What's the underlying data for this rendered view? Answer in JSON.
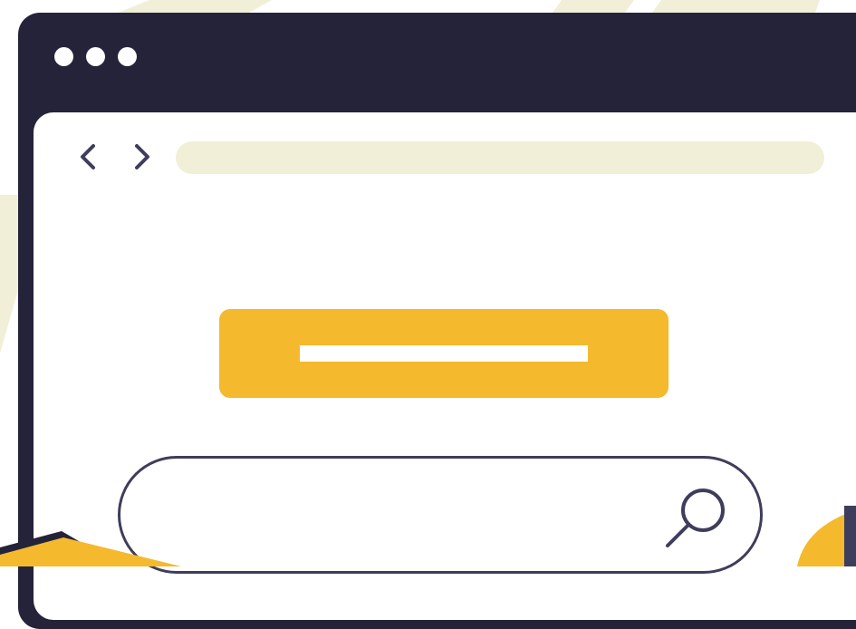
{
  "colors": {
    "background": "#ffffff",
    "background_shape": "#f2efd8",
    "window_frame": "#25233a",
    "content_bg": "#ffffff",
    "address_bar": "#f2efd8",
    "accent": "#f4b92d",
    "outline": "#3f3d5c"
  },
  "window": {
    "controls": [
      "dot",
      "dot",
      "dot"
    ]
  },
  "navigation": {
    "back_icon": "chevron-left-icon",
    "forward_icon": "chevron-right-icon"
  },
  "address_bar": {
    "value": ""
  },
  "cta": {
    "label": ""
  },
  "search": {
    "value": "",
    "icon": "search-icon"
  }
}
